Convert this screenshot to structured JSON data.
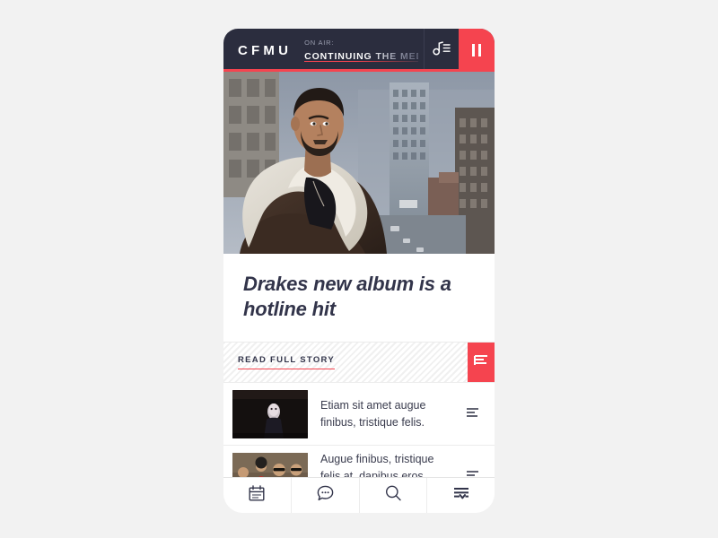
{
  "app": {
    "brand_color": "#f5444f",
    "dark_color": "#2b2d3e",
    "background_color": "#f2f2f2"
  },
  "topbar": {
    "logo": "CFMU",
    "onair_label": "ON AIR:",
    "onair_show": "CONTINUING THE MEDIA",
    "playlist_icon": "music-note-list-icon",
    "pause_icon": "pause-icon"
  },
  "hero": {
    "image_alt": "Man in shearling jacket on city rooftop",
    "name": "hero-image"
  },
  "headline": {
    "text": "Drakes new album is a hotline hit"
  },
  "readbar": {
    "label": "READ FULL STORY",
    "action_icon": "article-lines-icon"
  },
  "stories": [
    {
      "text": "Etiam sit amet augue finibus, tristique felis.",
      "thumb_alt": "Dark portrait thumbnail",
      "action_icon": "article-lines-icon"
    },
    {
      "text": "Augue finibus, tristique felis at, dapibus eros. Nam vesti ...",
      "thumb_alt": "Band group photo thumbnail",
      "action_icon": "article-lines-icon"
    }
  ],
  "bottom_nav": [
    {
      "icon": "calendar-icon",
      "label": "Schedule"
    },
    {
      "icon": "chat-bubble-icon",
      "label": "Chat"
    },
    {
      "icon": "search-icon",
      "label": "Search"
    },
    {
      "icon": "filter-chevron-icon",
      "label": "Filter"
    }
  ]
}
